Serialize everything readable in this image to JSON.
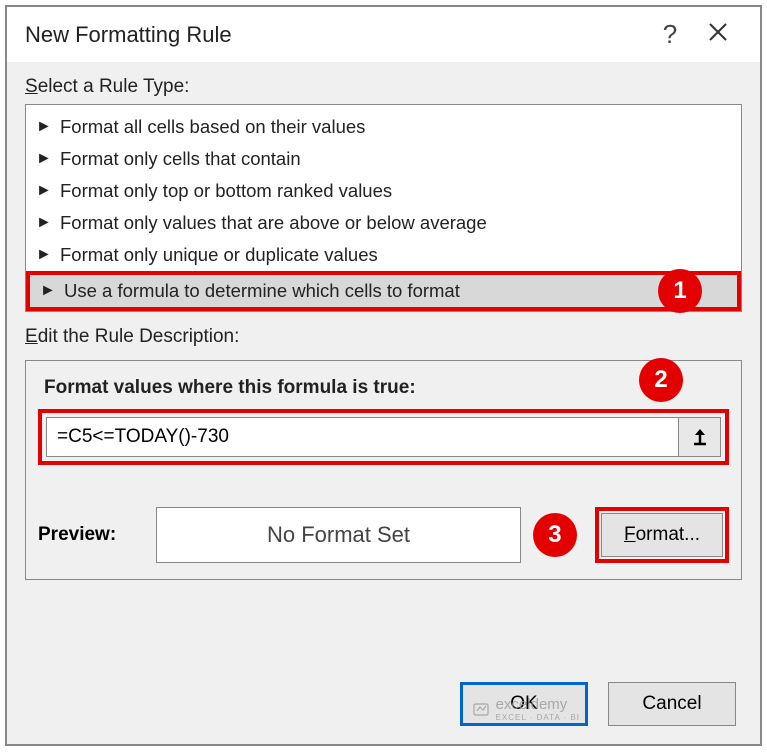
{
  "dialog": {
    "title": "New Formatting Rule"
  },
  "labels": {
    "select_rule_type": "elect a Rule Type:",
    "edit_rule_desc": "dit the Rule Description:",
    "formula_title": "Format values where this formula is true:",
    "preview": "Preview:",
    "format_btn": "ormat..."
  },
  "rule_types": [
    "Format all cells based on their values",
    "Format only cells that contain",
    "Format only top or bottom ranked values",
    "Format only values that are above or below average",
    "Format only unique or duplicate values",
    "Use a formula to determine which cells to format"
  ],
  "formula": "=C5<=TODAY()-730",
  "preview_text": "No Format Set",
  "buttons": {
    "ok": "OK",
    "cancel": "Cancel"
  },
  "callouts": {
    "c1": "1",
    "c2": "2",
    "c3": "3"
  },
  "watermark": {
    "name": "exceldemy",
    "sub": "EXCEL · DATA · BI"
  }
}
